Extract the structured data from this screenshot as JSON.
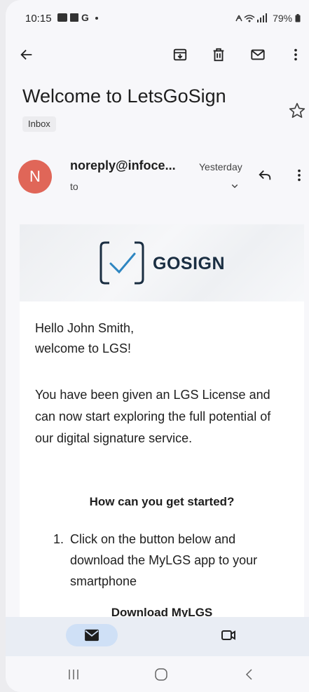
{
  "status": {
    "time": "10:15",
    "left_icons": "👥 ■ G •",
    "battery": "79%"
  },
  "toolbar": {
    "back_icon": "arrow-left-icon",
    "archive_icon": "archive-icon",
    "delete_icon": "trash-icon",
    "unread_icon": "mail-icon",
    "more_icon": "more-vert-icon"
  },
  "email": {
    "subject": "Welcome to LetsGoSign",
    "label": "Inbox",
    "avatar_letter": "N",
    "sender": "noreply@infoce...",
    "date": "Yesterday",
    "to": "to"
  },
  "body": {
    "logo_text": "GOSIGN",
    "greeting_line1": "Hello John Smith,",
    "greeting_line2": "welcome to LGS!",
    "paragraph": "You have been given an LGS License and can now start exploring the full potential of our digital signature service.",
    "heading": "How can you get started?",
    "step1_number": "1.",
    "step1_text": "Click on the button below and download the MyLGS app to your smartphone",
    "download_label": "Download MyLGS"
  },
  "colors": {
    "avatar": "#e06658",
    "nav_active": "#cfe0f6",
    "logo": "#1a2e42"
  }
}
